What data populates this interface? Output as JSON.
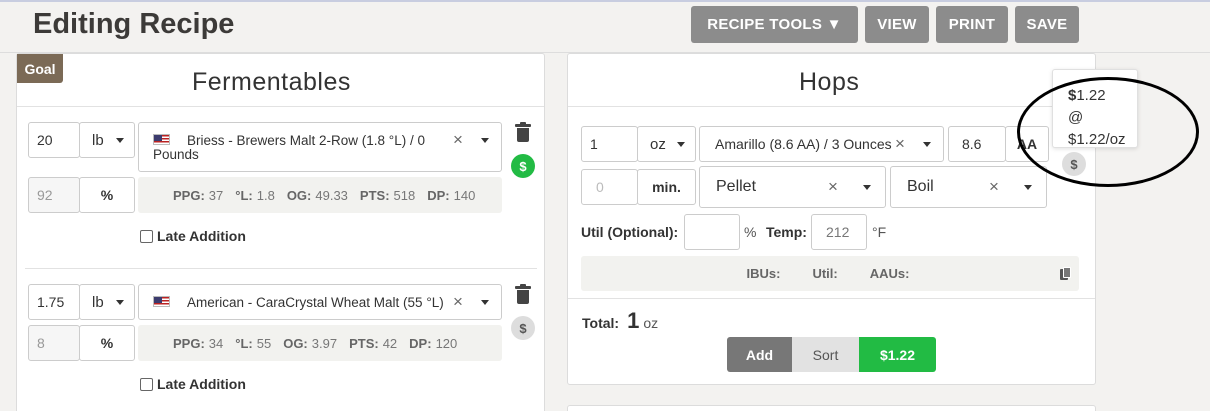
{
  "header": {
    "title": "Editing Recipe",
    "recipe_tools_label": "RECIPE TOOLS ▼",
    "view_label": "VIEW",
    "print_label": "PRINT",
    "save_label": "SAVE"
  },
  "goal_label": "Goal",
  "fermentables": {
    "title": "Fermentables",
    "items": [
      {
        "amount": "20",
        "unit": "lb",
        "name": "Briess - Brewers Malt 2-Row (1.8 °L) / 0 Pounds",
        "percent": "92",
        "percent_symbol": "%",
        "stats": {
          "ppg_label": "PPG:",
          "ppg": "37",
          "l_label": "°L:",
          "l": "1.8",
          "og_label": "OG:",
          "og": "49.33",
          "pts_label": "PTS:",
          "pts": "518",
          "dp_label": "DP:",
          "dp": "140"
        },
        "late_addition_label": "Late Addition",
        "price_symbol": "$",
        "price_status": "green"
      },
      {
        "amount": "1.75",
        "unit": "lb",
        "name": "American - CaraCrystal Wheat Malt (55 °L)",
        "percent": "8",
        "percent_symbol": "%",
        "stats": {
          "ppg_label": "PPG:",
          "ppg": "34",
          "l_label": "°L:",
          "l": "55",
          "og_label": "OG:",
          "og": "3.97",
          "pts_label": "PTS:",
          "pts": "42",
          "dp_label": "DP:",
          "dp": "120"
        },
        "late_addition_label": "Late Addition",
        "price_symbol": "$",
        "price_status": "grey"
      }
    ]
  },
  "hops": {
    "title": "Hops",
    "item": {
      "amount": "1",
      "unit": "oz",
      "name": "Amarillo (8.6 AA) / 3 Ounces",
      "aa": "8.6",
      "aa_label": "AA",
      "time_placeholder": "0",
      "time_unit": "min.",
      "form": "Pellet",
      "use": "Boil",
      "util_label": "Util (Optional):",
      "util_percent": "%",
      "temp_label": "Temp:",
      "temp_value": "212",
      "temp_unit": "°F",
      "ibus_label": "IBUs:",
      "util_stat_label": "Util:",
      "aaus_label": "AAUs:",
      "price_symbol": "$"
    },
    "total_label": "Total:",
    "total_value": "1",
    "total_unit": "oz",
    "add_label": "Add",
    "sort_label": "Sort",
    "price_button_label": "$1.22"
  },
  "tooltip": {
    "price": "1.22",
    "price_symbol": "$",
    "per_unit_prefix": "@ ",
    "per_unit_price": "$1.22",
    "per_unit_suffix": "/oz"
  },
  "colors": {
    "accent_green": "#22bb44",
    "button_grey": "#8c8c8c",
    "goal_brown": "#7b6a56"
  }
}
